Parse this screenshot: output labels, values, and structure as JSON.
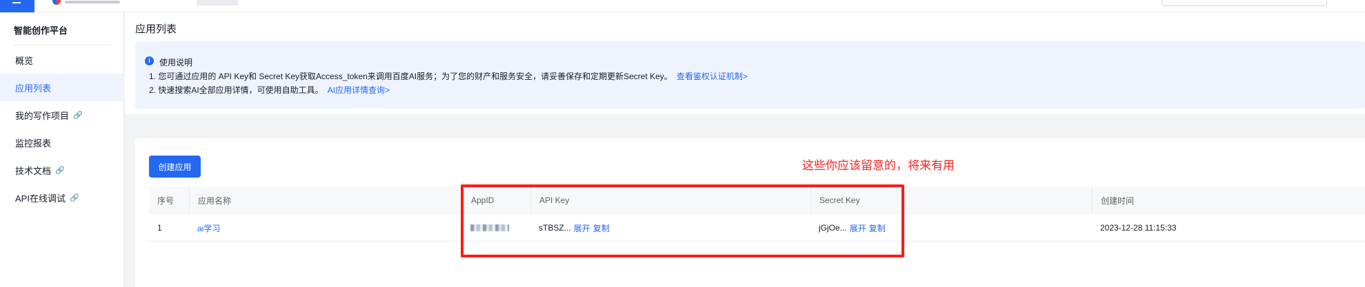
{
  "sidebar": {
    "brand": "智能创作平台",
    "items": [
      {
        "label": "概览",
        "active": false,
        "external": false
      },
      {
        "label": "应用列表",
        "active": true,
        "external": false
      },
      {
        "label": "我的写作项目",
        "active": false,
        "external": true
      },
      {
        "label": "监控报表",
        "active": false,
        "external": false
      },
      {
        "label": "技术文档",
        "active": false,
        "external": true
      },
      {
        "label": "API在线调试",
        "active": false,
        "external": true
      }
    ]
  },
  "page": {
    "title": "应用列表"
  },
  "notice": {
    "title": "使用说明",
    "line1": "1. 您可通过应用的 API Key和 Secret Key获取Access_token来调用百度AI服务；为了您的财产和服务安全，请妥善保存和定期更新Secret Key。",
    "line1_link": "查看鉴权认证机制>",
    "line2": "2. 快速搜索AI全部应用详情，可使用自助工具。",
    "line2_link": "AI应用详情查询>"
  },
  "toolbar": {
    "create_label": "创建应用"
  },
  "table": {
    "headers": [
      "序号",
      "应用名称",
      "AppID",
      "API Key",
      "Secret Key",
      "创建时间"
    ],
    "rows": [
      {
        "index": "1",
        "name": "ai学习",
        "appid_masked": "",
        "api_key": "sTBSZ...",
        "secret_key": "jGjOe...",
        "expand": "展开",
        "copy": "复制",
        "created": "2023-12-28 11:15:33"
      }
    ]
  },
  "annotation": {
    "text": "这些你应该留意的，将来有用"
  },
  "colors": {
    "accent": "#2468f2",
    "annotation": "#ff1a1a"
  }
}
